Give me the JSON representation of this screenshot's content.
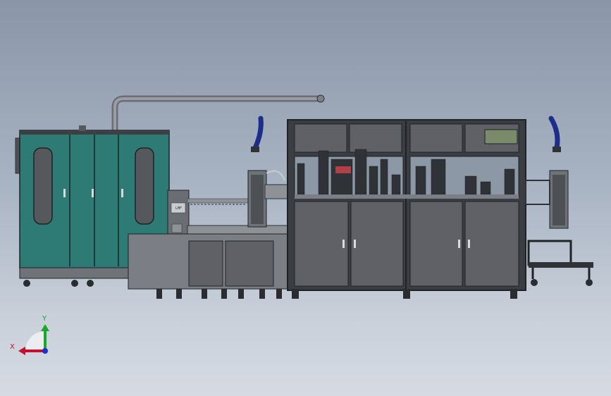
{
  "viewport": {
    "background_top": "#8a96a8",
    "background_bottom": "#d6dbe3"
  },
  "model": {
    "colors": {
      "teal_panel": "#2e7a75",
      "frame_dark": "#2f3236",
      "panel_gray": "#5f6166",
      "panel_gray_light": "#72757a",
      "window_glass": "#8c98a6",
      "steel": "#8e9196",
      "blue_hose": "#1c2d8a",
      "olive_panel": "#7a8a6a"
    },
    "placard_text": "LMF"
  },
  "triad": {
    "x_label": "X",
    "y_label": "Y",
    "x_color": "#c8102e",
    "y_color": "#1aa82a",
    "z_color": "#1b2fd6"
  }
}
